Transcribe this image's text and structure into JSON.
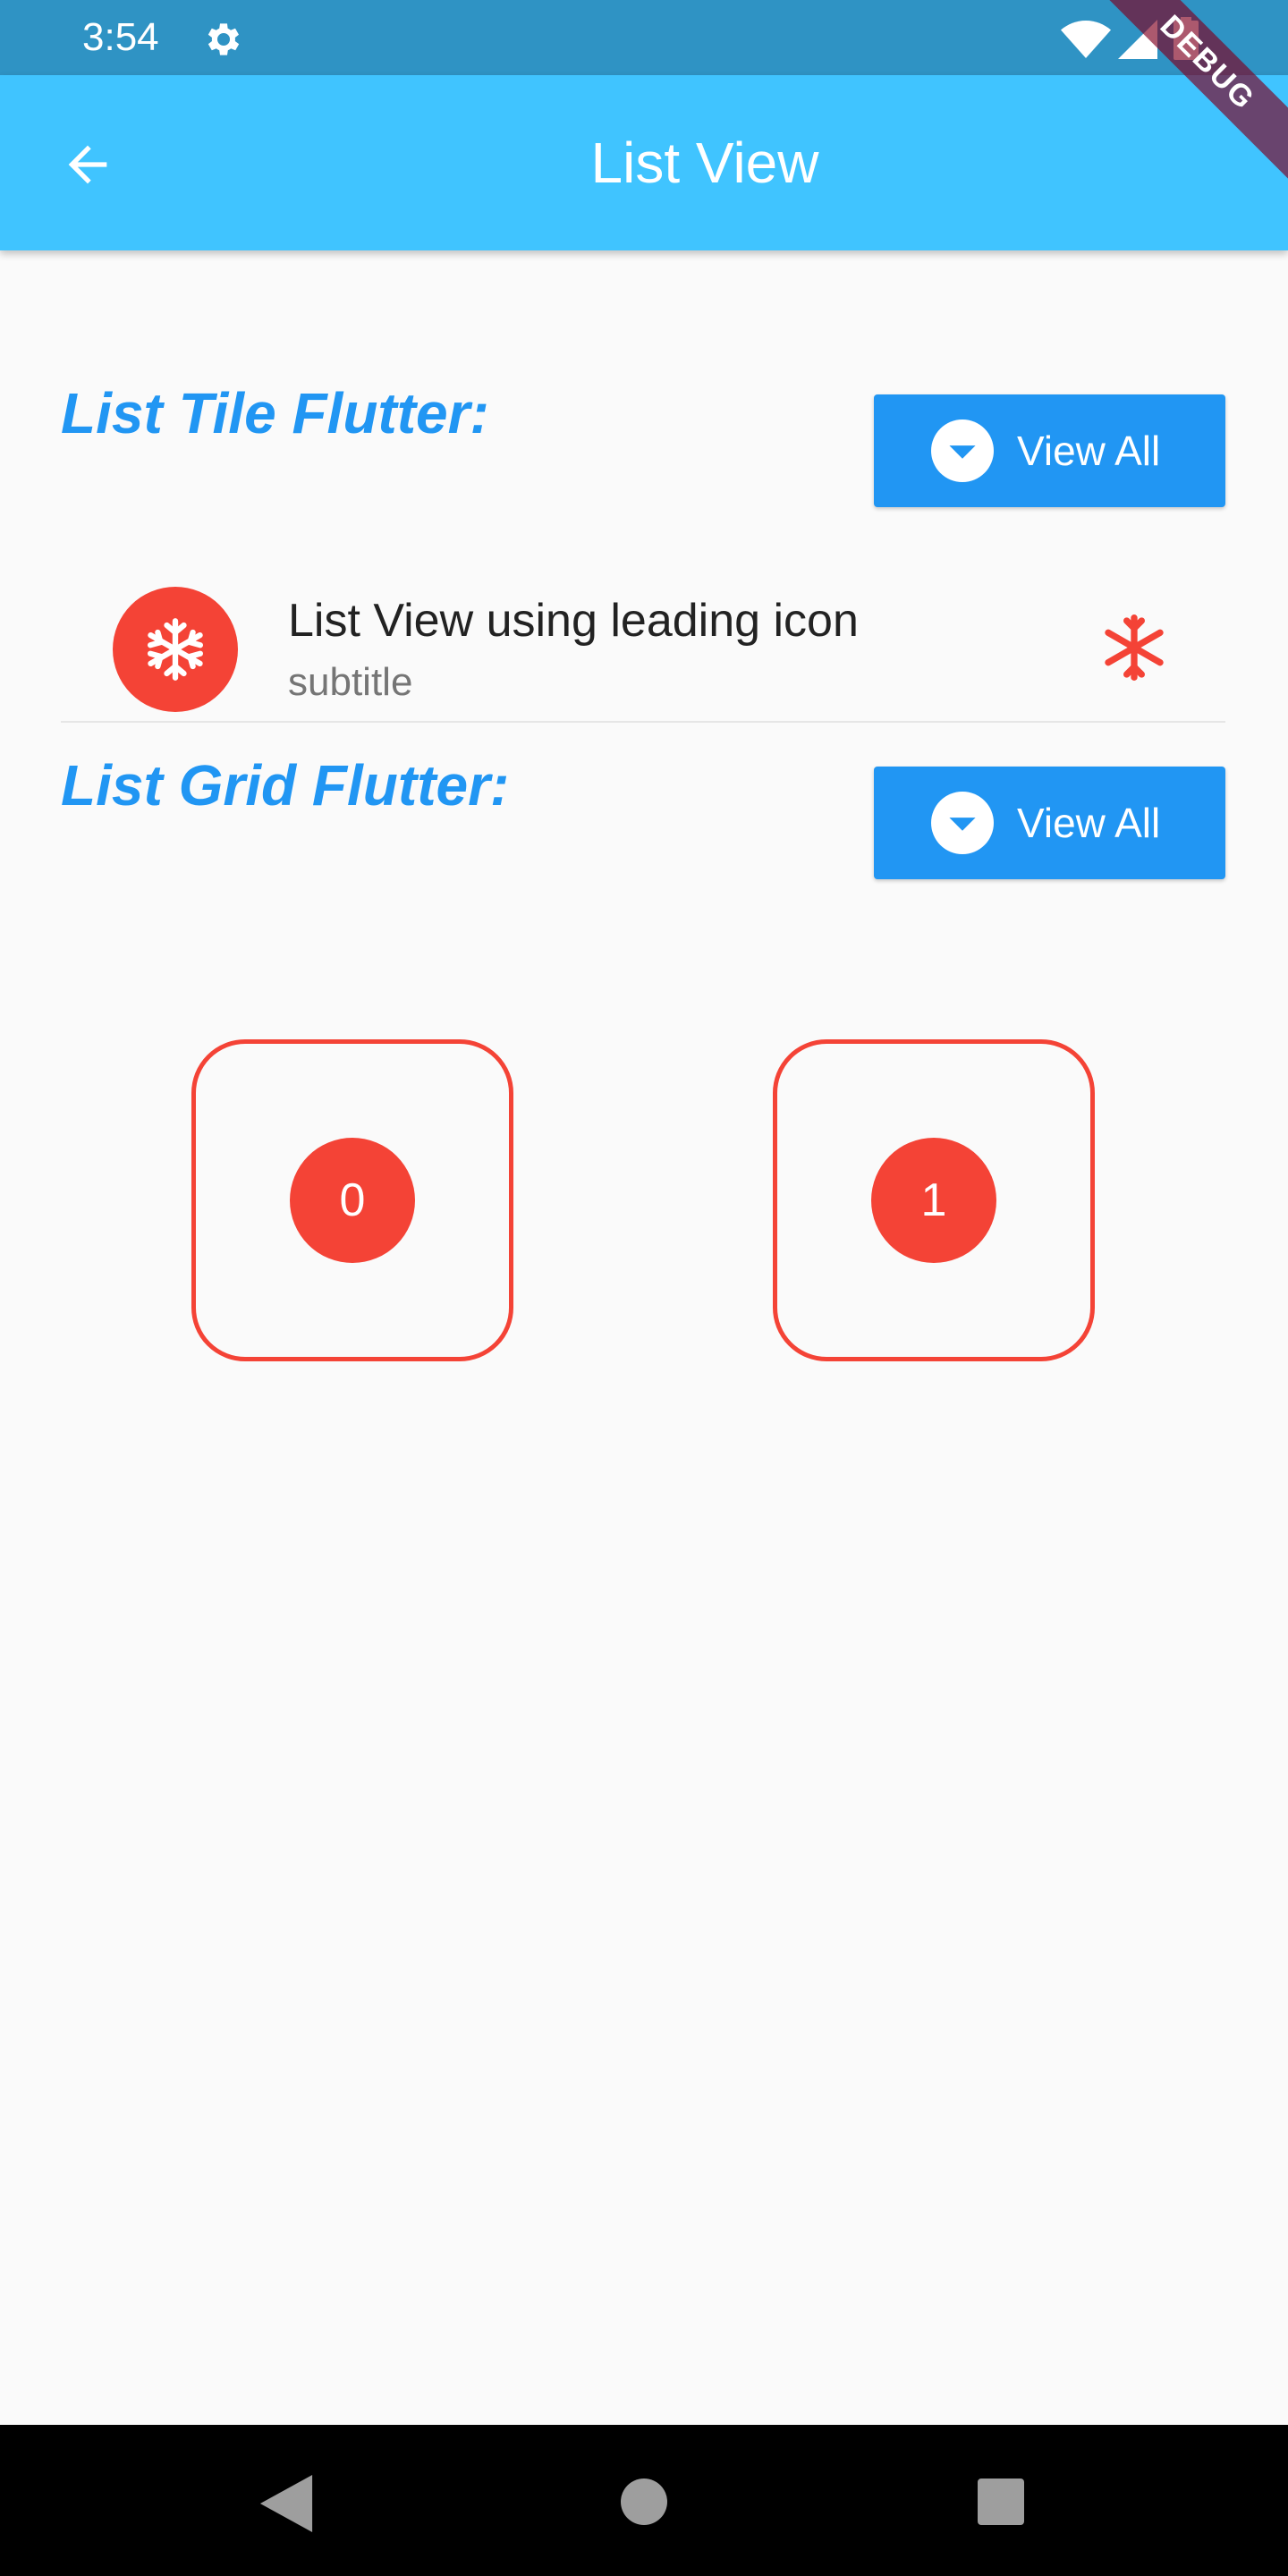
{
  "status_bar": {
    "time": "3:54"
  },
  "app_bar": {
    "title": "List View"
  },
  "debug_banner": {
    "label": "DEBUG"
  },
  "section_list_tile": {
    "heading": "List Tile Flutter:",
    "button_label": "View All"
  },
  "list_tile": {
    "title": "List View using leading icon",
    "subtitle": "subtitle",
    "leading_icon": "snowflake-icon",
    "trailing_icon": "asterisk-icon"
  },
  "section_list_grid": {
    "heading": "List Grid Flutter:",
    "button_label": "View All"
  },
  "grid_items": [
    {
      "label": "0"
    },
    {
      "label": "1"
    }
  ],
  "colors": {
    "status_bar": "#2f93c4",
    "app_bar": "#40c4ff",
    "accent": "#2196f3",
    "red": "#f44336"
  }
}
